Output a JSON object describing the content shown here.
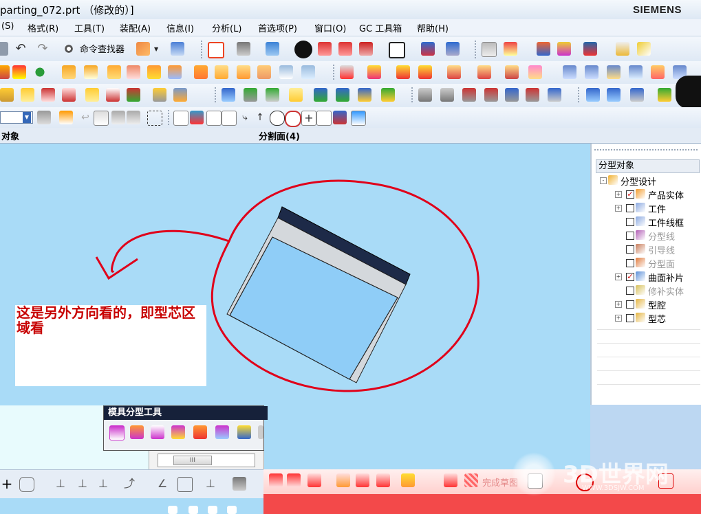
{
  "window": {
    "title": "parting_072.prt （修改的）]",
    "brand": "SIEMENS"
  },
  "menu": [
    {
      "label": "(S)"
    },
    {
      "label": "格式(R)"
    },
    {
      "label": "工具(T)"
    },
    {
      "label": "装配(A)"
    },
    {
      "label": "信息(I)"
    },
    {
      "label": "分析(L)"
    },
    {
      "label": "首选项(P)"
    },
    {
      "label": "窗口(O)"
    },
    {
      "label": "GC 工具箱"
    },
    {
      "label": "帮助(H)"
    }
  ],
  "toolbar": {
    "command_finder": "命令查找器"
  },
  "header": {
    "left": "对象",
    "center": "分割面(4)"
  },
  "panel": {
    "title": "分型对象",
    "tree": [
      {
        "label": "分型设计",
        "checked": null,
        "expand": "-",
        "dim": false
      },
      {
        "label": "产品实体",
        "checked": true,
        "expand": "+",
        "dim": false
      },
      {
        "label": "工件",
        "checked": false,
        "expand": "+",
        "dim": false
      },
      {
        "label": "工件线框",
        "checked": false,
        "expand": "",
        "dim": false
      },
      {
        "label": "分型线",
        "checked": false,
        "expand": "",
        "dim": true
      },
      {
        "label": "引导线",
        "checked": false,
        "expand": "",
        "dim": true
      },
      {
        "label": "分型面",
        "checked": false,
        "expand": "",
        "dim": true
      },
      {
        "label": "曲面补片",
        "checked": true,
        "expand": "+",
        "dim": false
      },
      {
        "label": "修补实体",
        "checked": false,
        "expand": "",
        "dim": true
      },
      {
        "label": "型腔",
        "checked": false,
        "expand": "+",
        "dim": false
      },
      {
        "label": "型芯",
        "checked": false,
        "expand": "+",
        "dim": false
      }
    ]
  },
  "annotation": {
    "text": "这是另外方向看的，即型芯区域看"
  },
  "mold_tools": {
    "title": "模具分型工具"
  },
  "bottom": {
    "finish_sketch": "完成草图"
  },
  "watermark": {
    "main": "3D世界网",
    "sub": "WWW.3DSJW.COM"
  },
  "colors": {
    "viewport": "#a9dbf7",
    "annotation": "#c70000",
    "redbar": "#f3494a"
  }
}
